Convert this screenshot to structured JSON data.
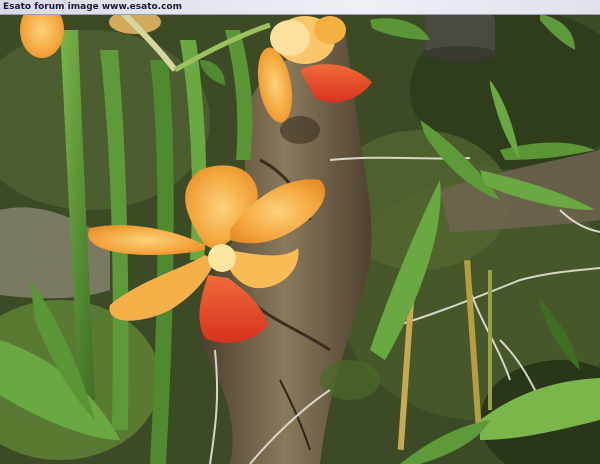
{
  "watermark": {
    "text": "Esato forum image www.esato.com"
  },
  "photo": {
    "subject": "orange-orchid-flowers",
    "colors": {
      "petal": "#f4a53c",
      "petal_light": "#f8c46a",
      "lip": "#e8442c",
      "leaf": "#5f9a3a",
      "leaf_dark": "#3e6e24",
      "bark": "#6a5a42"
    }
  }
}
